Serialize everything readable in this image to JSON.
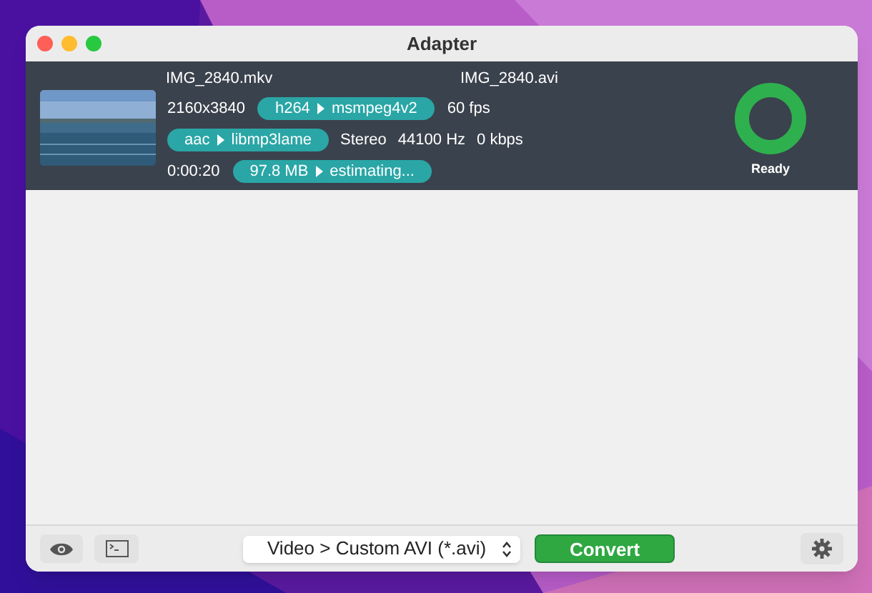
{
  "window": {
    "title": "Adapter"
  },
  "files": [
    {
      "input_name": "IMG_2840.mkv",
      "output_name": "IMG_2840.avi",
      "resolution": "2160x3840",
      "video_codec": {
        "from": "h264",
        "to": "msmpeg4v2"
      },
      "fps": "60 fps",
      "audio_codec": {
        "from": "aac",
        "to": "libmp3lame"
      },
      "channels": "Stereo",
      "sample_rate": "44100 Hz",
      "bitrate": "0 kbps",
      "duration": "0:00:20",
      "size": {
        "from": "97.8 MB",
        "to": "estimating..."
      },
      "progress": {
        "status": "Ready"
      }
    }
  ],
  "toolbar": {
    "preset": "Video > Custom AVI (*.avi)",
    "convert": "Convert"
  }
}
